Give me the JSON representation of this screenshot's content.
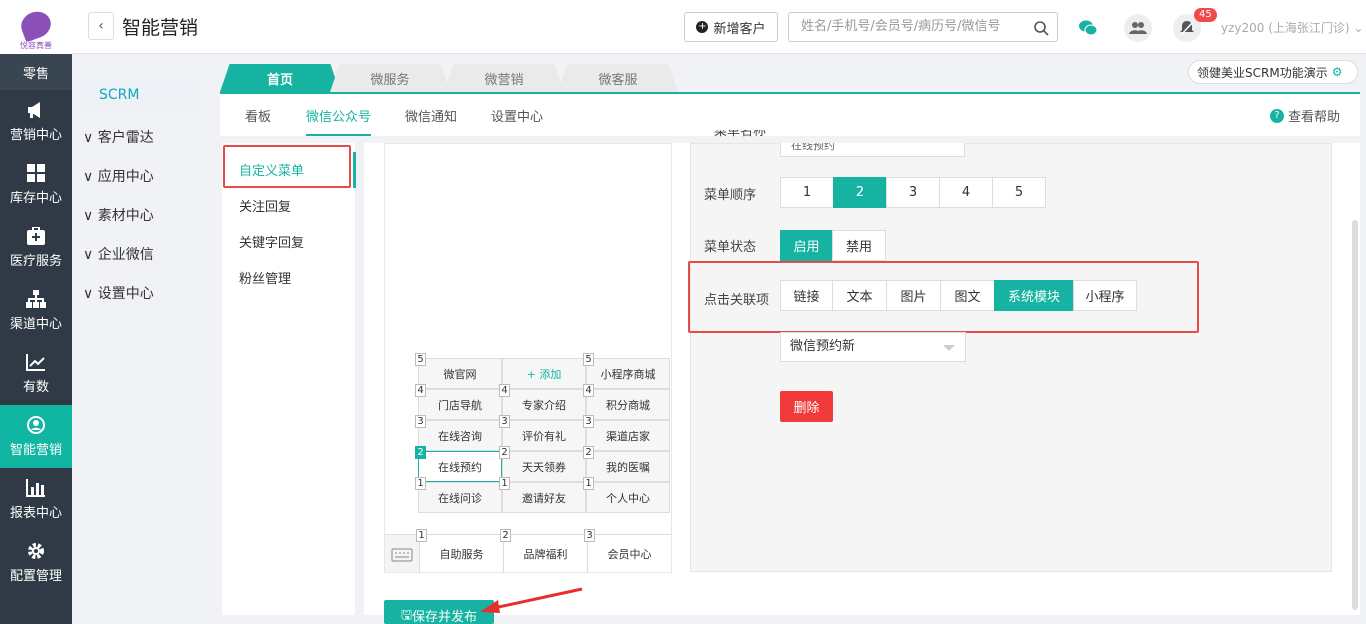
{
  "brand": {
    "name": "悦容真善"
  },
  "rail": [
    {
      "label": "零售",
      "icon": "store-icon"
    },
    {
      "label": "营销中心",
      "icon": "megaphone-icon"
    },
    {
      "label": "库存中心",
      "icon": "grid-icon"
    },
    {
      "label": "医疗服务",
      "icon": "medkit-icon"
    },
    {
      "label": "渠道中心",
      "icon": "hierarchy-icon"
    },
    {
      "label": "有数",
      "icon": "trend-icon"
    },
    {
      "label": "智能营销",
      "icon": "smart-marketing-icon",
      "active": true
    },
    {
      "label": "报表中心",
      "icon": "bar-chart-icon"
    },
    {
      "label": "配置管理",
      "icon": "gear-icon"
    }
  ],
  "header": {
    "title": "智能营销",
    "new_customer": "新增客户",
    "search_placeholder": "姓名/手机号/会员号/病历号/微信号",
    "badge": "45",
    "user": "yzy200 (上海张江门诊)"
  },
  "side": {
    "selected": "SCRM",
    "items": [
      "客户雷达",
      "应用中心",
      "素材中心",
      "企业微信",
      "设置中心"
    ]
  },
  "tabs": [
    "首页",
    "微服务",
    "微营销",
    "微客服"
  ],
  "demo_button": "领健美业SCRM功能演示",
  "subnav": {
    "items": [
      "看板",
      "微信公众号",
      "微信通知",
      "设置中心"
    ],
    "active": 1,
    "help": "查看帮助"
  },
  "leftmenu": {
    "items": [
      "自定义菜单",
      "关注回复",
      "关键字回复",
      "粉丝管理"
    ],
    "active": 0
  },
  "menu_grid": {
    "rows": [
      [
        {
          "n": "5",
          "t": "微官网"
        },
        {
          "n": "",
          "t": "+ 添加",
          "add": true
        },
        {
          "n": "5",
          "t": "小程序商城"
        }
      ],
      [
        {
          "n": "4",
          "t": "门店导航"
        },
        {
          "n": "4",
          "t": "专家介绍"
        },
        {
          "n": "4",
          "t": "积分商城"
        }
      ],
      [
        {
          "n": "3",
          "t": "在线咨询"
        },
        {
          "n": "3",
          "t": "评价有礼"
        },
        {
          "n": "3",
          "t": "渠道店家"
        }
      ],
      [
        {
          "n": "2",
          "t": "在线预约",
          "sel": true
        },
        {
          "n": "2",
          "t": "天天领券"
        },
        {
          "n": "2",
          "t": "我的医嘱"
        }
      ],
      [
        {
          "n": "1",
          "t": "在线问诊"
        },
        {
          "n": "1",
          "t": "邀请好友"
        },
        {
          "n": "1",
          "t": "个人中心"
        }
      ]
    ],
    "bottom": [
      {
        "n": "1",
        "t": "自助服务"
      },
      {
        "n": "2",
        "t": "品牌福利"
      },
      {
        "n": "3",
        "t": "会员中心"
      }
    ]
  },
  "form": {
    "name_label": "菜单名称",
    "name_value": "在线预约",
    "order_label": "菜单顺序",
    "order_options": [
      "1",
      "2",
      "3",
      "4",
      "5"
    ],
    "order_selected": "2",
    "status_label": "菜单状态",
    "status_options": [
      "启用",
      "禁用"
    ],
    "status_selected": "启用",
    "link_label": "点击关联项",
    "link_options": [
      "链接",
      "文本",
      "图片",
      "图文",
      "系统模块",
      "小程序"
    ],
    "link_selected": "系统模块",
    "module_value": "微信预约新",
    "delete": "删除"
  },
  "save_button": "保存并发布",
  "colors": {
    "accent": "#16b3a2",
    "danger": "#f13a3a",
    "highlight": "#e84a4a"
  }
}
